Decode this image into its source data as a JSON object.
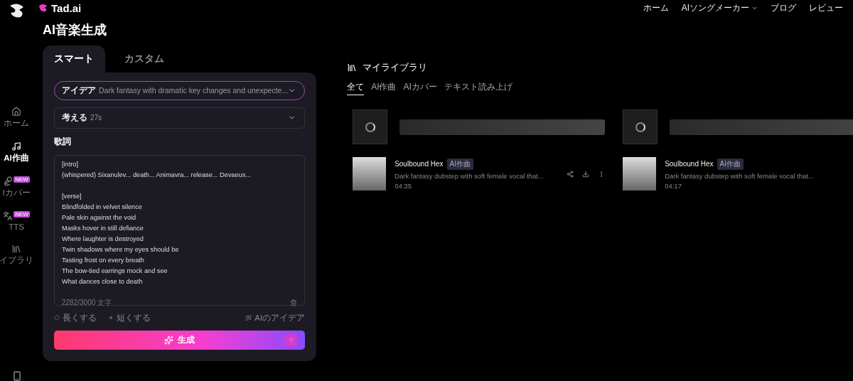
{
  "brand": "Tad.ai",
  "nav": [
    {
      "label": "ホーム",
      "dropdown": false
    },
    {
      "label": "AIソングメーカー",
      "dropdown": true
    },
    {
      "label": "ブログ",
      "dropdown": false
    },
    {
      "label": "レビュー",
      "dropdown": false
    }
  ],
  "sidebar": [
    {
      "kind": "home",
      "label": "ホーム",
      "selected": false
    },
    {
      "kind": "compose",
      "label": "AI作曲",
      "selected": true
    },
    {
      "kind": "cover",
      "label": "Iカバー",
      "selected": false,
      "badge": "NEW"
    },
    {
      "kind": "tts",
      "label": "TTS",
      "selected": false,
      "badge": "NEW"
    },
    {
      "kind": "library",
      "label": "イブラリ",
      "selected": false
    }
  ],
  "title": "AI音楽生成",
  "mode_tabs": [
    {
      "label": "スマート",
      "selected": true
    },
    {
      "label": "カスタム",
      "selected": false
    }
  ],
  "idea": {
    "label": "アイデア",
    "value": "Dark fantasy with dramatic key changes and unexpecte..."
  },
  "thinking": {
    "label": "考える",
    "time": "27s"
  },
  "lyrics_label": "歌詞",
  "lyrics": [
    {
      "lines": [
        "[intro]",
        "(whispered) Sixanulev... death... Animavra... release... Devaeus..."
      ]
    },
    {
      "lines": [
        "[verse]",
        "Blindfolded in velvet silence",
        "Pale skin against the void",
        "Masks hover in still defiance",
        "Where laughter is destroyed",
        "Twin shadows where my eyes should be",
        "Tasting frost on every breath",
        "The bow-tied earrings mock and see",
        "What dances close to death"
      ]
    }
  ],
  "char_count": "2282/3000 文字",
  "actions": [
    {
      "kind": "longer",
      "label": "長くする"
    },
    {
      "kind": "shorter",
      "label": "短くする"
    }
  ],
  "ai_idea": "AIのアイデア",
  "generate": "生成",
  "library": {
    "title": "マイライブラリ",
    "tabs": [
      {
        "label": "全て",
        "selected": true
      },
      {
        "label": "AI作曲",
        "selected": false
      },
      {
        "label": "AIカバー",
        "selected": false
      },
      {
        "label": "テキスト読み上げ",
        "selected": false
      }
    ],
    "columns": [
      {
        "song": {
          "title": "Soulbound Hex",
          "tag": "AI作曲",
          "description": "Dark fantasy dubstep with soft female vocal that...",
          "duration": "04:35",
          "actions": true
        }
      },
      {
        "song": {
          "title": "Soulbound Hex",
          "tag": "AI作曲",
          "description": "Dark fantasy dubstep with soft female vocal that...",
          "duration": "04:17",
          "actions": false
        }
      }
    ]
  }
}
